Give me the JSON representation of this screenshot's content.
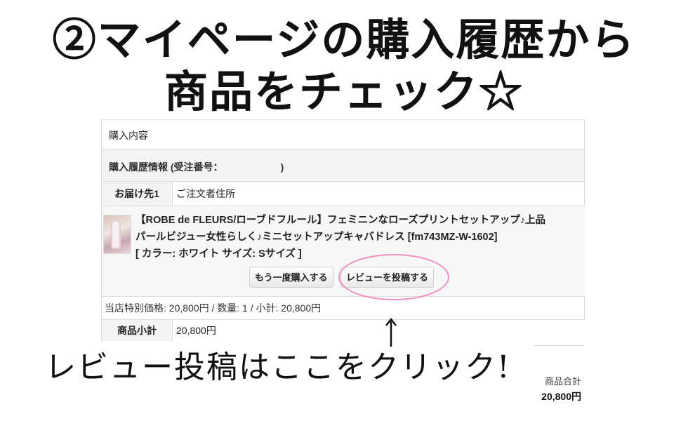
{
  "headline": {
    "line1": "②マイページの購入履歴から",
    "line2": "商品をチェック☆"
  },
  "order": {
    "section_title": "購入内容",
    "history_label": "購入履歴情報 (受注番号：",
    "history_close": ")",
    "destination_label": "お届け先1",
    "destination_value": "ご注文者住所",
    "product": {
      "line1": "【ROBE de FLEURS/ローブドフルール】フェミニンなローズプリントセットアップ♪上品",
      "line2": "パールビジュー女性らしく♪ミニセットアップキャバドレス [fm743MZ-W-1602]",
      "line3": "[ カラー: ホワイト サイズ: Sサイズ ]",
      "rebuy_button": "もう一度購入する",
      "review_button": "レビューを投稿する"
    },
    "price_line": "当店特別価格: 20,800円 / 数量: 1 / 小計: 20,800円",
    "subtotal_label": "商品小計",
    "subtotal_value": "20,800円",
    "total_label": "商品合計",
    "total_value": "20,800円"
  },
  "annotation": {
    "callout": "レビュー投稿はここをクリック!",
    "highlight_color": "#f28fc0"
  }
}
